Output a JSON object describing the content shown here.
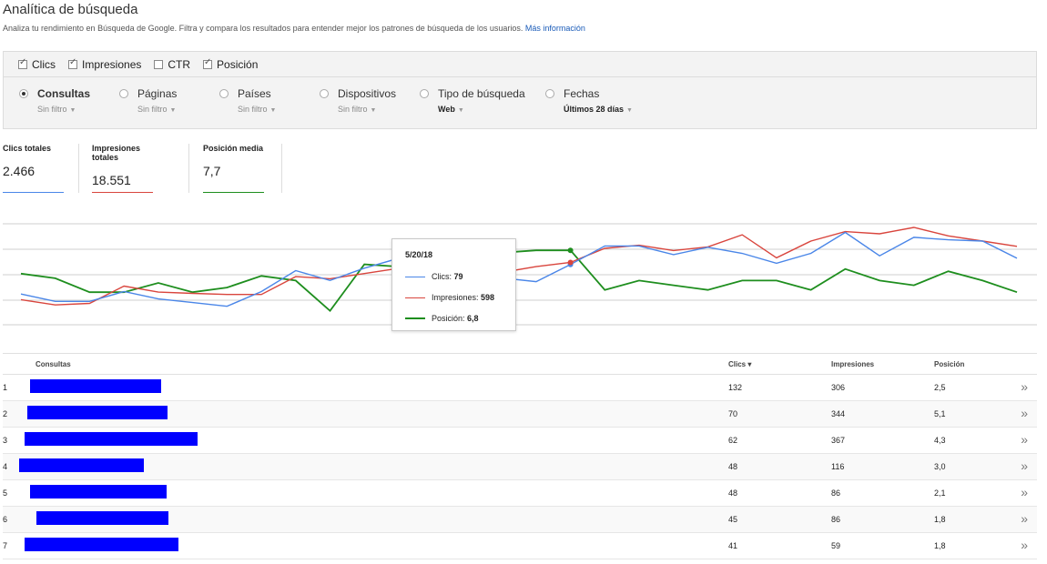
{
  "header": {
    "title": "Analítica de búsqueda",
    "description": "Analiza tu rendimiento en Búsqueda de Google. Filtra y compara los resultados para entender mejor los patrones de búsqueda de los usuarios.",
    "link": "Más información"
  },
  "metrics": [
    {
      "label": "Clics",
      "checked": true
    },
    {
      "label": "Impresiones",
      "checked": true
    },
    {
      "label": "CTR",
      "checked": false
    },
    {
      "label": "Posición",
      "checked": true
    }
  ],
  "dimensions": [
    {
      "label": "Consultas",
      "filter": "Sin filtro",
      "selected": true
    },
    {
      "label": "Páginas",
      "filter": "Sin filtro",
      "selected": false
    },
    {
      "label": "Países",
      "filter": "Sin filtro",
      "selected": false
    },
    {
      "label": "Dispositivos",
      "filter": "Sin filtro",
      "selected": false
    },
    {
      "label": "Tipo de búsqueda",
      "filter": "Web",
      "selected": false
    },
    {
      "label": "Fechas",
      "filter": "Últimos 28 días",
      "selected": false
    }
  ],
  "totals": [
    {
      "label": "Clics totales",
      "value": "2.466",
      "color": "#4a86e8"
    },
    {
      "label": "Impresiones totales",
      "value": "18.551",
      "color": "#d9453d"
    },
    {
      "label": "Posición media",
      "value": "7,7",
      "color": "#1e8e1e"
    }
  ],
  "tooltip": {
    "date": "5/20/18",
    "rows": [
      {
        "label": "Clics: ",
        "value": "79"
      },
      {
        "label": "Impresiones: ",
        "value": "598"
      },
      {
        "label": "Posición: ",
        "value": "6,8"
      }
    ]
  },
  "chart_data": {
    "type": "line",
    "grid": true,
    "highlight_index": 16,
    "series": [
      {
        "name": "Clics",
        "color": "#4a86e8",
        "values": [
          55,
          49,
          49,
          57,
          51,
          48,
          45,
          57,
          74,
          66,
          76,
          84,
          78,
          70,
          68,
          65,
          79,
          94,
          94,
          87,
          93,
          88,
          80,
          88,
          105,
          86,
          101,
          99,
          98,
          84
        ]
      },
      {
        "name": "Impresiones",
        "color": "#d9453d",
        "values": [
          420,
          395,
          402,
          485,
          456,
          450,
          445,
          445,
          530,
          520,
          545,
          570,
          585,
          600,
          550,
          578,
          598,
          665,
          680,
          655,
          672,
          730,
          620,
          700,
          745,
          735,
          765,
          725,
          700,
          675
        ]
      },
      {
        "name": "Posición",
        "color": "#1e8e1e",
        "values": [
          7.8,
          8.0,
          8.6,
          8.6,
          8.2,
          8.6,
          8.4,
          7.9,
          8.1,
          9.4,
          7.4,
          7.5,
          7.4,
          7.0,
          6.9,
          6.8,
          6.8,
          8.5,
          8.1,
          8.3,
          8.5,
          8.1,
          8.1,
          8.5,
          7.6,
          8.1,
          8.3,
          7.7,
          8.1,
          8.6
        ]
      }
    ]
  },
  "table": {
    "headers": {
      "query": "Consultas",
      "clicks": "Clics ▾",
      "impressions": "Impresiones",
      "position": "Posición"
    },
    "rows": [
      {
        "n": "1",
        "clicks": "132",
        "impressions": "306",
        "position": "2,5"
      },
      {
        "n": "2",
        "clicks": "70",
        "impressions": "344",
        "position": "5,1"
      },
      {
        "n": "3",
        "clicks": "62",
        "impressions": "367",
        "position": "4,3"
      },
      {
        "n": "4",
        "clicks": "48",
        "impressions": "116",
        "position": "3,0"
      },
      {
        "n": "5",
        "clicks": "48",
        "impressions": "86",
        "position": "2,1"
      },
      {
        "n": "6",
        "clicks": "45",
        "impressions": "86",
        "position": "1,8"
      },
      {
        "n": "7",
        "clicks": "41",
        "impressions": "59",
        "position": "1,8"
      }
    ]
  }
}
